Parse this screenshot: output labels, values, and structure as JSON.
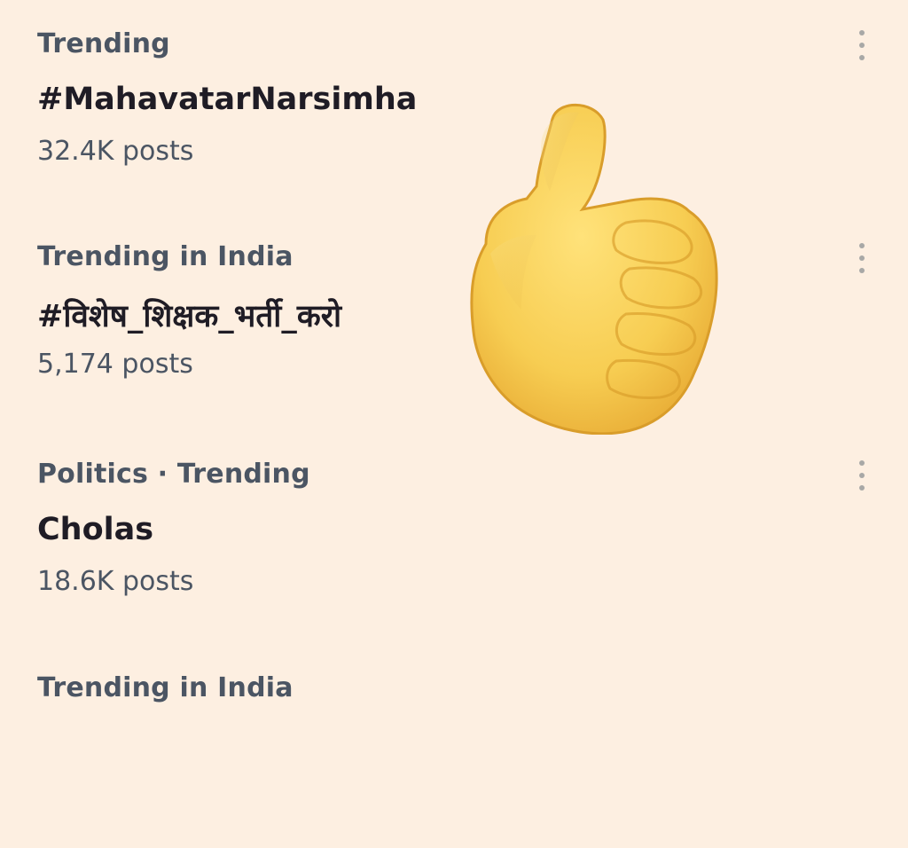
{
  "trends": [
    {
      "context": "Trending",
      "title": "#MahavatarNarsimha",
      "count": "32.4K posts"
    },
    {
      "context": "Trending in India",
      "title": "#विशेष_शिक्षक_भर्ती_करो",
      "count": "5,174 posts"
    },
    {
      "context": "Politics · Trending",
      "title": "Cholas",
      "count": "18.6K posts"
    },
    {
      "context": "Trending in India",
      "title": "",
      "count": ""
    }
  ],
  "overlay": {
    "icon": "thumbs-up-icon"
  },
  "colors": {
    "background": "#fdefe1",
    "primary_text": "#1f1c25",
    "secondary_text": "#4b5563",
    "menu_dots": "#a8a8a6",
    "thumb_yellow": "#f7cd52"
  }
}
